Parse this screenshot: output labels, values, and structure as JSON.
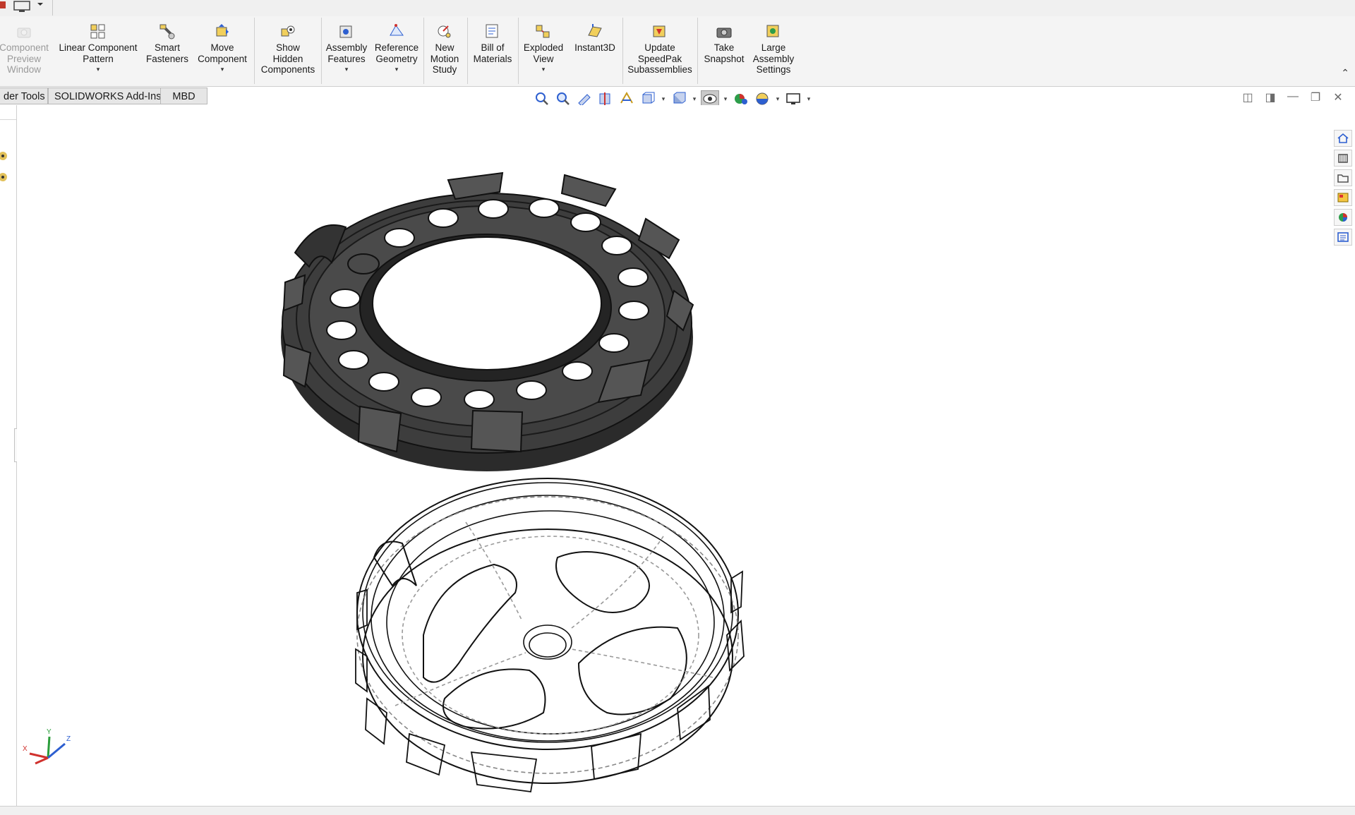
{
  "ribbon": {
    "buttons": [
      {
        "label_lines": [
          "Component",
          "Preview",
          "Window"
        ],
        "disabled": true,
        "dropdown": false
      },
      {
        "label_lines": [
          "Linear Component",
          "Pattern"
        ],
        "disabled": false,
        "dropdown": true
      },
      {
        "label_lines": [
          "Smart",
          "Fasteners"
        ],
        "disabled": false,
        "dropdown": false
      },
      {
        "label_lines": [
          "Move",
          "Component"
        ],
        "disabled": false,
        "dropdown": true
      },
      {
        "label_lines": [
          "Show",
          "Hidden",
          "Components"
        ],
        "disabled": false,
        "dropdown": false
      },
      {
        "label_lines": [
          "Assembly",
          "Features"
        ],
        "disabled": false,
        "dropdown": true
      },
      {
        "label_lines": [
          "Reference",
          "Geometry"
        ],
        "disabled": false,
        "dropdown": true
      },
      {
        "label_lines": [
          "New",
          "Motion",
          "Study"
        ],
        "disabled": false,
        "dropdown": false
      },
      {
        "label_lines": [
          "Bill of",
          "Materials"
        ],
        "disabled": false,
        "dropdown": false
      },
      {
        "label_lines": [
          "Exploded",
          "View"
        ],
        "disabled": false,
        "dropdown": true
      },
      {
        "label_lines": [
          "Instant3D"
        ],
        "disabled": false,
        "dropdown": false
      },
      {
        "label_lines": [
          "Update",
          "SpeedPak",
          "Subassemblies"
        ],
        "disabled": false,
        "dropdown": false
      },
      {
        "label_lines": [
          "Take",
          "Snapshot"
        ],
        "disabled": false,
        "dropdown": false
      },
      {
        "label_lines": [
          "Large",
          "Assembly",
          "Settings"
        ],
        "disabled": false,
        "dropdown": false
      }
    ],
    "collapse_glyph": "⌃"
  },
  "tabs": [
    {
      "label": "der Tools"
    },
    {
      "label": "SOLIDWORKS Add-Ins"
    },
    {
      "label": "MBD"
    }
  ],
  "heads_up_toolbar": {
    "items": [
      "zoom-to-fit-icon",
      "zoom-to-area-icon",
      "previous-view-icon",
      "section-view-icon",
      "dynamic-annotation-icon",
      "view-orientation-icon",
      "display-style-icon",
      "hide-show-items-icon",
      "edit-appearance-icon",
      "apply-scene-icon",
      "view-settings-icon"
    ],
    "active_item": "hide-show-items-icon"
  },
  "window_controls": [
    "◫",
    "◨",
    "—",
    "❐",
    "✕"
  ],
  "triad": {
    "x_label": "X",
    "y_label": "Y",
    "z_label": "Z"
  },
  "colors": {
    "ribbon_bg": "#f4f4f4",
    "tab_bg": "#e6e6e6",
    "icon_accent": "#c79a1c",
    "model_shaded": "#3a3a3a",
    "axis_x": "#d0312d",
    "axis_y": "#2a9d3a",
    "axis_z": "#2d5fd0"
  }
}
